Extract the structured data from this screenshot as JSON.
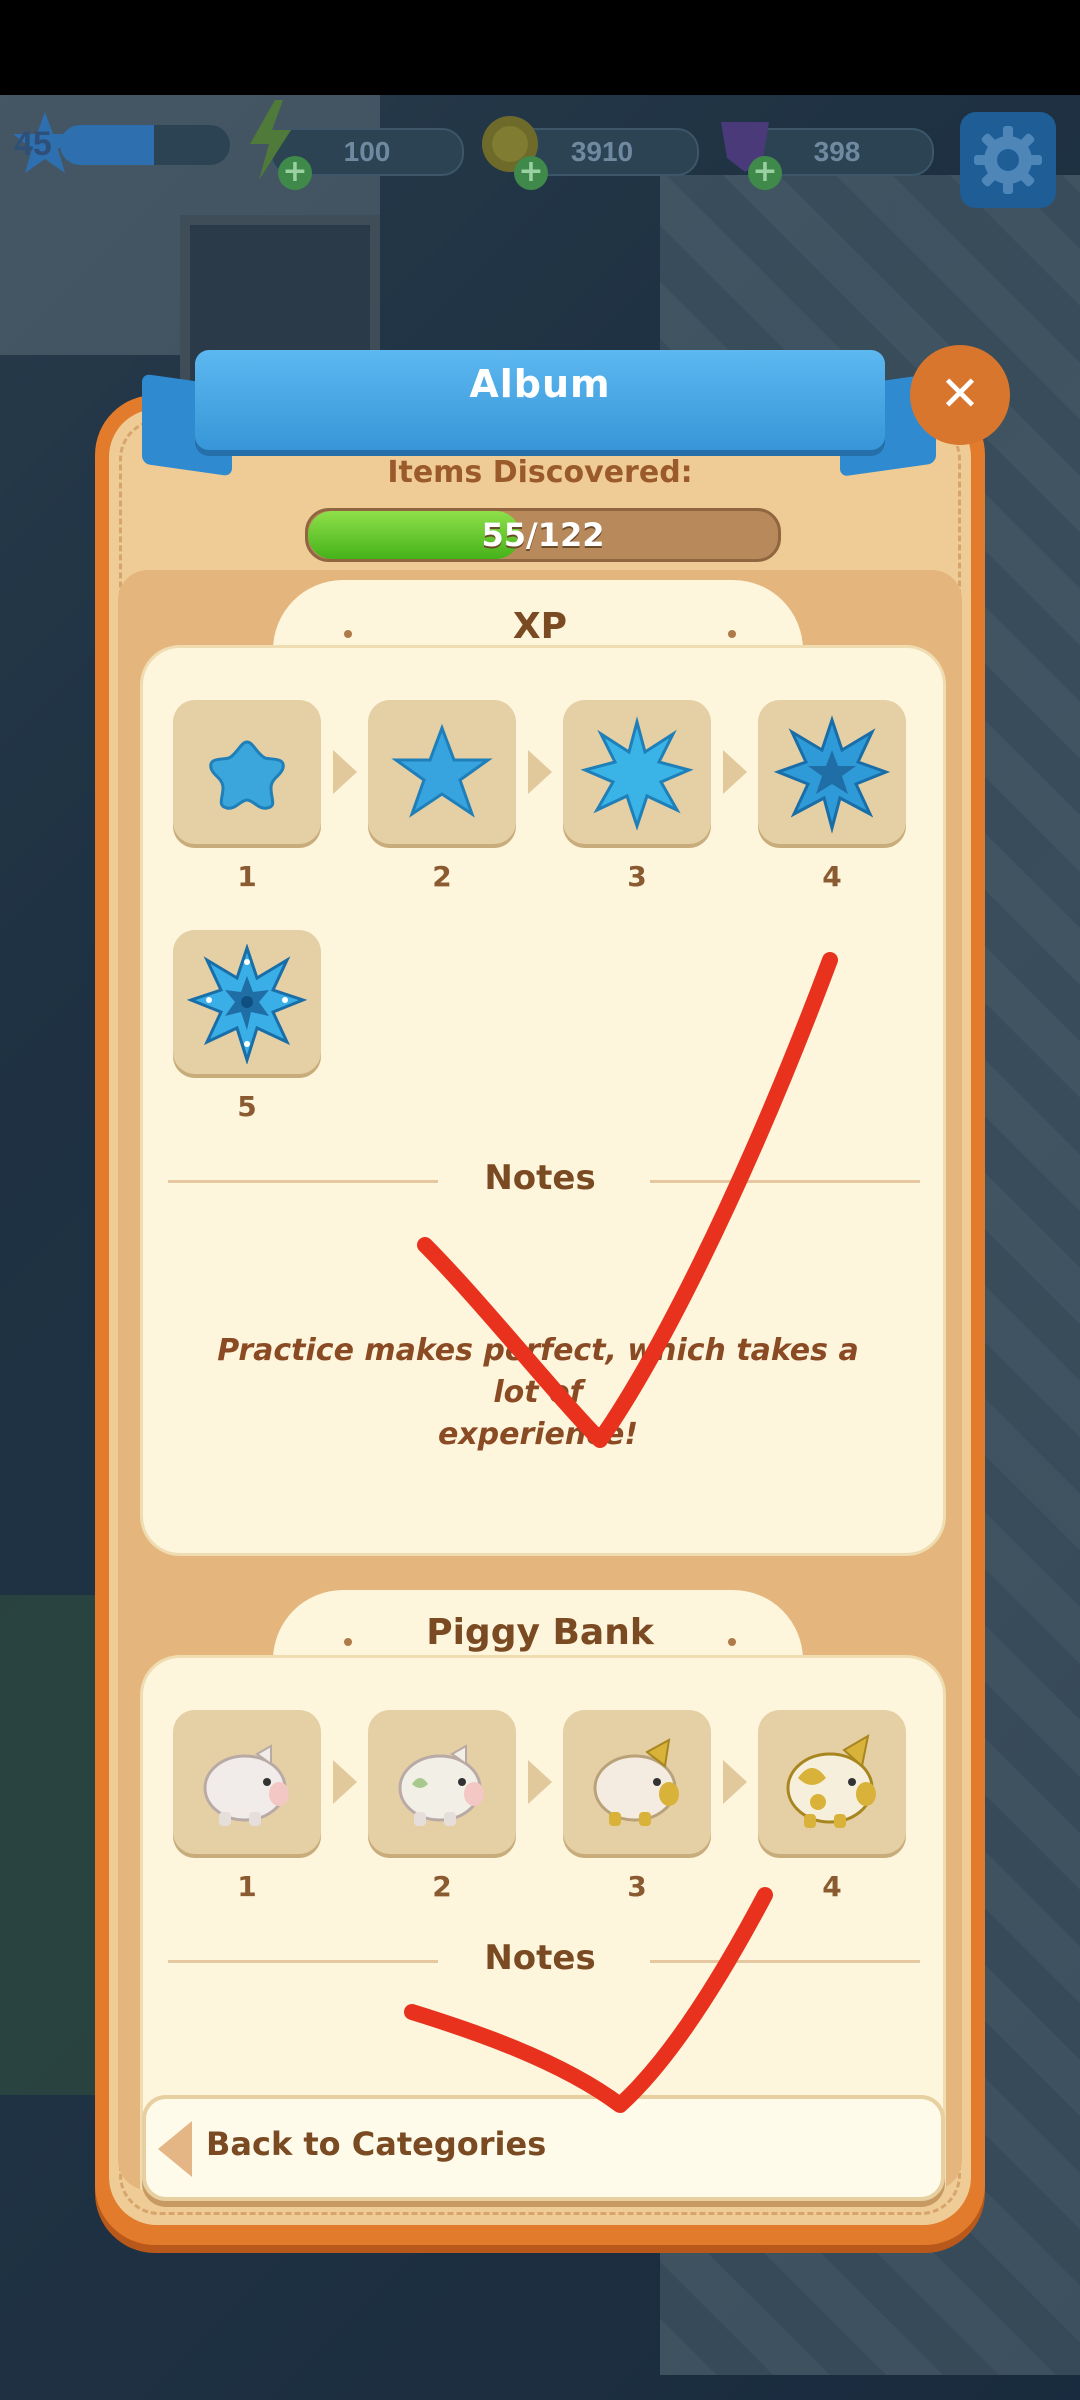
{
  "hud": {
    "level": "45",
    "level_progress": 0.55,
    "energy": "100",
    "coins": "3910",
    "gems": "398"
  },
  "dialog": {
    "title": "Album",
    "discovered_label": "Items Discovered:",
    "discovered_text": "55/122",
    "discovered_count": 55,
    "discovered_total": 122,
    "categories": [
      {
        "title": "XP",
        "items": [
          "1",
          "2",
          "3",
          "4",
          "5"
        ],
        "notes_title": "Notes",
        "note_line1": "Practice makes perfect, which takes a lot of",
        "note_line2": "experience!"
      },
      {
        "title": "Piggy Bank",
        "items": [
          "1",
          "2",
          "3",
          "4"
        ],
        "notes_title": "Notes"
      }
    ],
    "back_label": "Back to Categories"
  },
  "colors": {
    "accent_blue": "#3796d8",
    "frame_orange": "#e27b2c",
    "progress_green": "#45b21a",
    "annotation_red": "#e8321e"
  }
}
